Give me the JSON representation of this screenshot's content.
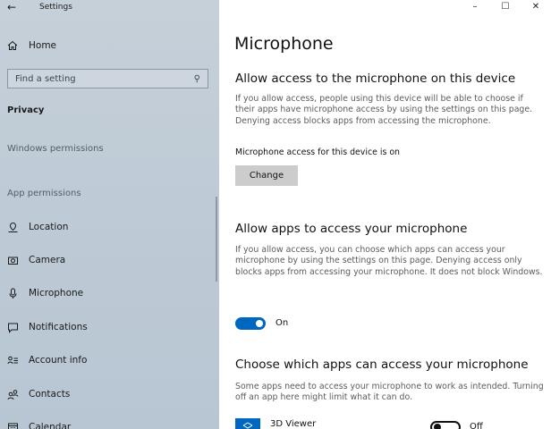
{
  "window": {
    "title": "Settings",
    "minimize": "–",
    "maximize": "☐",
    "close": "✕"
  },
  "sidebar": {
    "home": "Home",
    "search_placeholder": "Find a setting",
    "category": "Privacy",
    "section_windows": "Windows permissions",
    "section_app": "App permissions",
    "items": [
      {
        "label": "Location",
        "icon": "location-icon"
      },
      {
        "label": "Camera",
        "icon": "camera-icon"
      },
      {
        "label": "Microphone",
        "icon": "microphone-icon"
      },
      {
        "label": "Notifications",
        "icon": "notifications-icon"
      },
      {
        "label": "Account info",
        "icon": "account-info-icon"
      },
      {
        "label": "Contacts",
        "icon": "contacts-icon"
      },
      {
        "label": "Calendar",
        "icon": "calendar-icon"
      }
    ]
  },
  "main": {
    "title": "Microphone",
    "device": {
      "heading": "Allow access to the microphone on this device",
      "desc": "If you allow access, people using this device will be able to choose if their apps have microphone access by using the settings on this page. Denying access blocks apps from accessing the microphone.",
      "status": "Microphone access for this device is on",
      "change_label": "Change"
    },
    "apps": {
      "heading": "Allow apps to access your microphone",
      "desc": "If you allow access, you can choose which apps can access your microphone by using the settings on this page. Denying access only blocks apps from accessing your microphone. It does not block Windows.",
      "toggle_state": "On"
    },
    "choose": {
      "heading": "Choose which apps can access your microphone",
      "desc": "Some apps need to access your microphone to work as intended. Turning off an app here might limit what it can do.",
      "app_list": [
        {
          "name": "3D Viewer",
          "state": "Off"
        }
      ]
    }
  },
  "colors": {
    "accent": "#0067c0",
    "sidebar_bg": "#c2cdd7"
  }
}
